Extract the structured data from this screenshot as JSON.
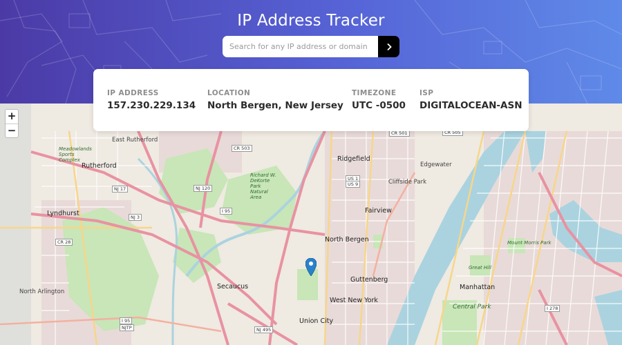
{
  "app": {
    "title": "IP Address Tracker"
  },
  "search": {
    "placeholder": "Search for any IP address or domain",
    "value": ""
  },
  "stats": {
    "ip": {
      "label": "IP ADDRESS",
      "value": "157.230.229.134"
    },
    "location": {
      "label": "LOCATION",
      "value": "North Bergen, New Jersey"
    },
    "timezone": {
      "label": "TIMEZONE",
      "value": "UTC -0500"
    },
    "isp": {
      "label": "ISP",
      "value": "DIGITALOCEAN-ASN"
    }
  },
  "map": {
    "zoom_in": "+",
    "zoom_out": "−",
    "places": {
      "east_rutherford": "East Rutherford",
      "rutherford": "Rutherford",
      "lyndhurst": "Lyndhurst",
      "north_arlington": "North Arlington",
      "ridgefield": "Ridgefield",
      "edgewater": "Edgewater",
      "cliffside_park": "Cliffside Park",
      "fairview": "Fairview",
      "north_bergen": "North Bergen",
      "guttenberg": "Guttenberg",
      "west_new_york": "West New York",
      "secaucus": "Secaucus",
      "union_city": "Union City",
      "manhattan": "Manhattan",
      "central_park": "Central Park",
      "great_hill": "Great Hill",
      "mount_morris": "Mount Morris Park",
      "richard_kane": "Richard W. DeKorte Park Natural Area",
      "meadowlands": "Meadowlands Sports Complex"
    },
    "shields": {
      "cr503": "CR 503",
      "cr501": "CR 501",
      "cr505": "CR 505",
      "nj17": "NJ 17",
      "nj120": "NJ 120",
      "nj3": "NJ 3",
      "cr28": "CR 28",
      "i95a": "I 95",
      "i95b": "I 95",
      "i95c": "I 95",
      "i95njtp": "NJTP",
      "nj495": "NJ 495",
      "us1": "US 1",
      "us9": "US 9",
      "i278": "I 278"
    }
  },
  "colors": {
    "header_start": "#4b3aa6",
    "header_end": "#5f8ae8",
    "button": "#000000",
    "water": "#aad3df",
    "park": "#c8e6b8",
    "highway": "#e892a2",
    "marker": "#2a81cb"
  }
}
